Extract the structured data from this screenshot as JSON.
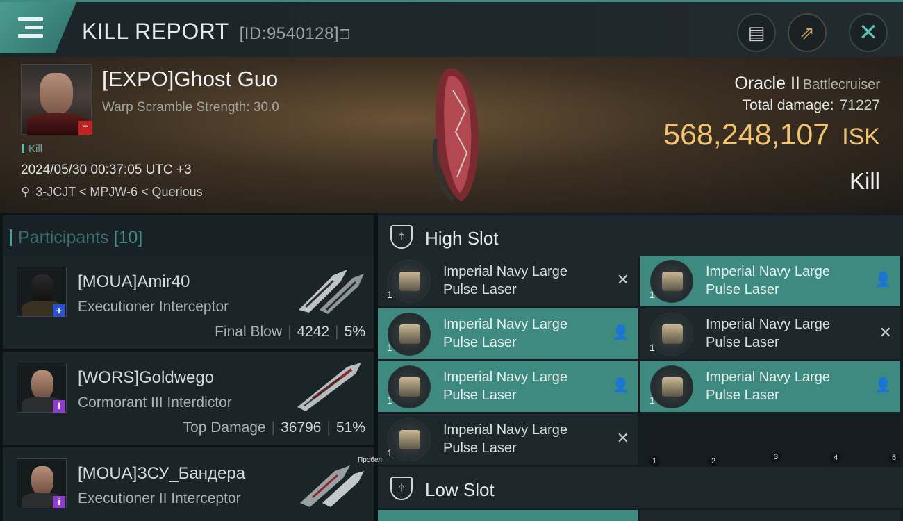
{
  "header": {
    "title": "KILL REPORT",
    "report_id": "[ID:9540128]",
    "clipboard_icon": "clipboard-icon",
    "share_icon": "share-icon",
    "close_icon": "close-icon"
  },
  "victim": {
    "name": "[EXPO]Ghost Guo",
    "warp_scramble": "Warp Scramble Strength: 30.0",
    "tag": "Kill",
    "datetime": "2024/05/30 00:37:05 UTC +3",
    "location": "3-JCJT < MPJW-6 < Querious",
    "ship": "Oracle II",
    "ship_class": "Battlecruiser",
    "total_damage_label": "Total damage:",
    "total_damage": "71227",
    "isk_value": "568,248,107",
    "isk_unit": "ISK",
    "result": "Kill",
    "security_badge": "−"
  },
  "participants": {
    "label": "Participants",
    "count": "[10]",
    "list": [
      {
        "name": "[MOUA]Amir40",
        "ship": "Executioner Interceptor",
        "role": "Final Blow",
        "damage": "4242",
        "percent": "5%",
        "badge": "+",
        "badge_color": "#2a52c9"
      },
      {
        "name": "[WORS]Goldwego",
        "ship": "Cormorant III Interdictor",
        "role": "Top Damage",
        "damage": "36796",
        "percent": "51%",
        "badge": "i",
        "badge_color": "#8a3fc4"
      },
      {
        "name": "[MOUA]ЗСУ_Бандера",
        "ship": "Executioner II Interceptor",
        "badge": "i",
        "badge_color": "#8a3fc4"
      }
    ]
  },
  "high_slot": {
    "label": "High Slot",
    "items": [
      {
        "name": "Imperial Navy Large Pulse Laser",
        "qty": "1",
        "state": "destroyed",
        "action_icon": "close-icon"
      },
      {
        "name": "Imperial Navy Large Pulse Laser",
        "qty": "1",
        "state": "dropped",
        "action_icon": "person-icon"
      },
      {
        "name": "Imperial Navy Large Pulse Laser",
        "qty": "1",
        "state": "dropped",
        "action_icon": "person-icon"
      },
      {
        "name": "Imperial Navy Large Pulse Laser",
        "qty": "1",
        "state": "destroyed",
        "action_icon": "close-icon"
      },
      {
        "name": "Imperial Navy Large Pulse Laser",
        "qty": "1",
        "state": "dropped",
        "action_icon": "person-icon"
      },
      {
        "name": "Imperial Navy Large Pulse Laser",
        "qty": "1",
        "state": "dropped",
        "action_icon": "person-icon"
      },
      {
        "name": "Imperial Navy Large Pulse Laser",
        "qty": "1",
        "state": "destroyed",
        "action_icon": "close-icon"
      }
    ]
  },
  "low_slot": {
    "label": "Low Slot"
  },
  "hotkeys": [
    "1",
    "2",
    "3",
    "4",
    "5"
  ],
  "tooltip": "Пробел",
  "colors": {
    "accent": "#3f8a80",
    "isk": "#f2c46f",
    "kill_red": "#c4201f"
  }
}
